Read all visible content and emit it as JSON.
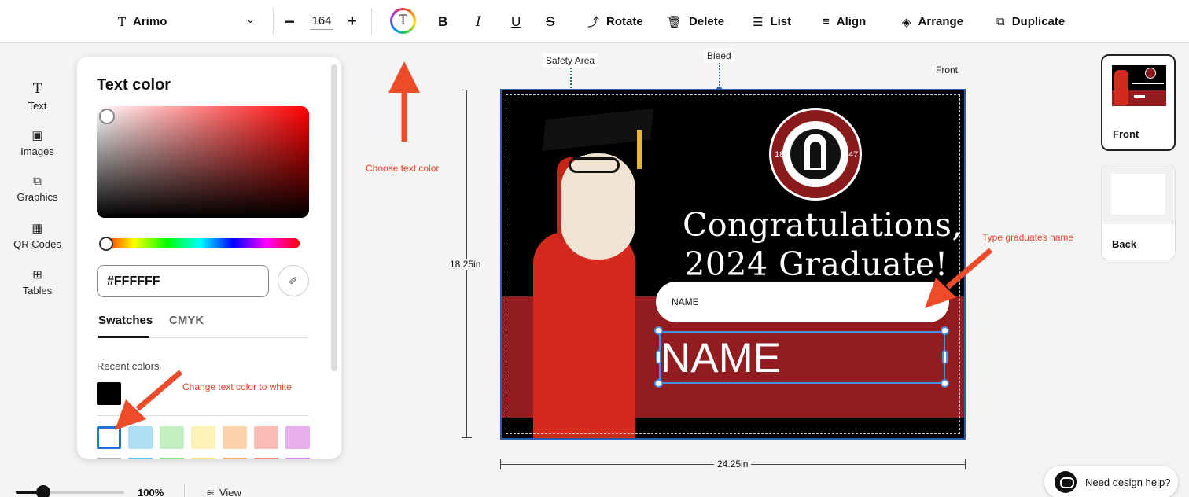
{
  "toolbar": {
    "font_icon": "T",
    "font_name": "Arimo",
    "font_size": "164",
    "minus": "−",
    "plus": "+",
    "color_icon": "T",
    "bold": "B",
    "italic": "I",
    "underline": "U",
    "strike": "S",
    "rotate": "Rotate",
    "delete": "Delete",
    "list": "List",
    "align": "Align",
    "arrange": "Arrange",
    "duplicate": "Duplicate"
  },
  "sidebar": {
    "items": [
      {
        "label": "Text",
        "icon": "T"
      },
      {
        "label": "Images",
        "icon": "▣"
      },
      {
        "label": "Graphics",
        "icon": "⧉"
      },
      {
        "label": "QR Codes",
        "icon": "▦"
      },
      {
        "label": "Tables",
        "icon": "⊞"
      }
    ]
  },
  "color_panel": {
    "title": "Text color",
    "hex_value": "#FFFFFF",
    "tabs": [
      "Swatches",
      "CMYK"
    ],
    "recent_label": "Recent colors",
    "recent_colors": [
      "#000000"
    ],
    "swatches": [
      "#ffffff",
      "#ade0f5",
      "#c4efc2",
      "#fdf2b8",
      "#fad3ab",
      "#f9bcb7",
      "#e6aeed"
    ],
    "swatches_row2": [
      "#b8b8b8",
      "#6cc7ef",
      "#8fdf8e",
      "#fbe689",
      "#f7b46c",
      "#f58a82",
      "#d68be6"
    ]
  },
  "canvas": {
    "safety_label": "Safety Area",
    "bleed_label": "Bleed",
    "side_label": "Front",
    "height_label": "18.25in",
    "width_label": "24.25in",
    "seal_year_left": "18",
    "seal_year_right": "47",
    "headline_1": "Congratulations,",
    "headline_2": "2024 Graduate!",
    "name_input": "NAME",
    "name_text": "NAME",
    "band_color": "#921c1f"
  },
  "annotations": {
    "choose_color": "Choose text color",
    "change_white": "Change text color to white",
    "type_name": "Type graduates name"
  },
  "pages": [
    {
      "label": "Front"
    },
    {
      "label": "Back"
    }
  ],
  "bottom": {
    "zoom": "100%",
    "zoom_fraction": 0.25,
    "view": "View",
    "help": "Need design help?"
  }
}
